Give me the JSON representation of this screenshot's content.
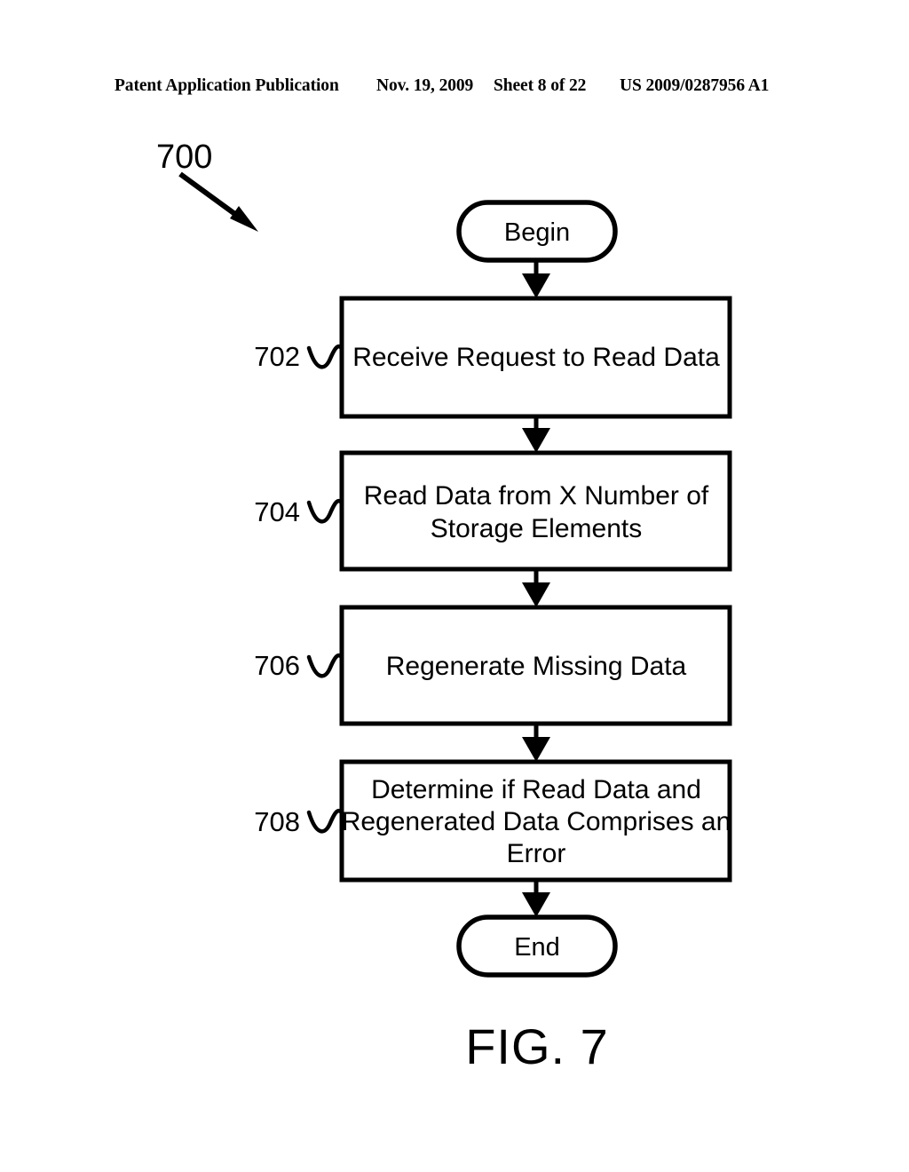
{
  "header": {
    "publication": "Patent Application Publication",
    "date": "Nov. 19, 2009",
    "sheet": "Sheet 8 of 22",
    "patent_number": "US 2009/0287956 A1"
  },
  "figure": {
    "caption": "FIG. 7",
    "diagram_ref": "700",
    "start_node": {
      "id": "begin",
      "label": "Begin"
    },
    "end_node": {
      "id": "end",
      "label": "End"
    },
    "steps": [
      {
        "ref": "702",
        "lines": [
          "Receive Request to Read Data"
        ]
      },
      {
        "ref": "704",
        "lines": [
          "Read Data from X Number of",
          "Storage Elements"
        ]
      },
      {
        "ref": "706",
        "lines": [
          "Regenerate Missing Data"
        ]
      },
      {
        "ref": "708",
        "lines": [
          "Determine if Read Data and",
          "Regenerated Data Comprises an",
          "Error"
        ]
      }
    ]
  },
  "colors": {
    "ink": "#000000",
    "paper": "#ffffff"
  }
}
